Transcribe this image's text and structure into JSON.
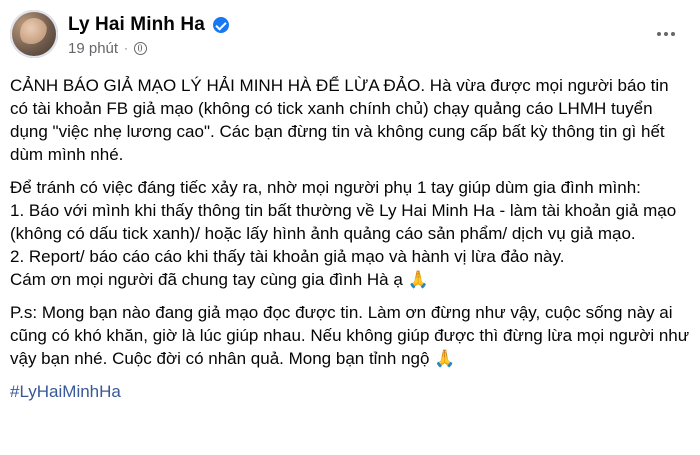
{
  "post": {
    "author": "Ly Hai Minh Ha",
    "time": "19 phút",
    "separator": "·",
    "paragraphs": [
      "CẢNH BÁO GIẢ MẠO LÝ HẢI MINH HÀ ĐỂ LỪA ĐẢO. Hà vừa được mọi người báo tin có tài khoản FB giả mạo (không có tick xanh chính chủ) chạy quảng cáo LHMH tuyển dụng \"việc nhẹ lương cao\". Các bạn đừng tin và không cung cấp bất kỳ thông tin gì hết dùm mình nhé.",
      "Để tránh có việc đáng tiếc xảy ra, nhờ mọi người phụ 1 tay giúp dùm gia đình mình:\n1. Báo với mình khi thấy thông tin bất thường về Ly Hai Minh Ha - làm tài khoản giả mạo (không có dấu tick xanh)/ hoặc lấy hình ảnh quảng cáo sản phẩm/ dịch vụ giả mạo.\n2. Report/ báo cáo cáo khi thấy tài khoản giả mạo và hành vị lừa đảo này.\nCám ơn mọi người đã chung tay cùng gia đình Hà ạ 🙏",
      "P.s: Mong bạn nào đang giả mạo đọc được tin. Làm ơn đừng như vậy, cuộc sống này ai cũng có khó khăn, giờ là lúc giúp nhau. Nếu không giúp được thì đừng lừa mọi người như vậy bạn nhé. Cuộc đời có nhân quả. Mong bạn tỉnh ngộ 🙏"
    ],
    "hashtag": "#LyHaiMinhHa"
  },
  "icons": {
    "verified": "verified-badge-icon",
    "privacy": "globe-icon",
    "more": "more-options-icon"
  },
  "colors": {
    "verified": "#1877f2",
    "meta": "#65676b",
    "hashtag": "#385898"
  }
}
